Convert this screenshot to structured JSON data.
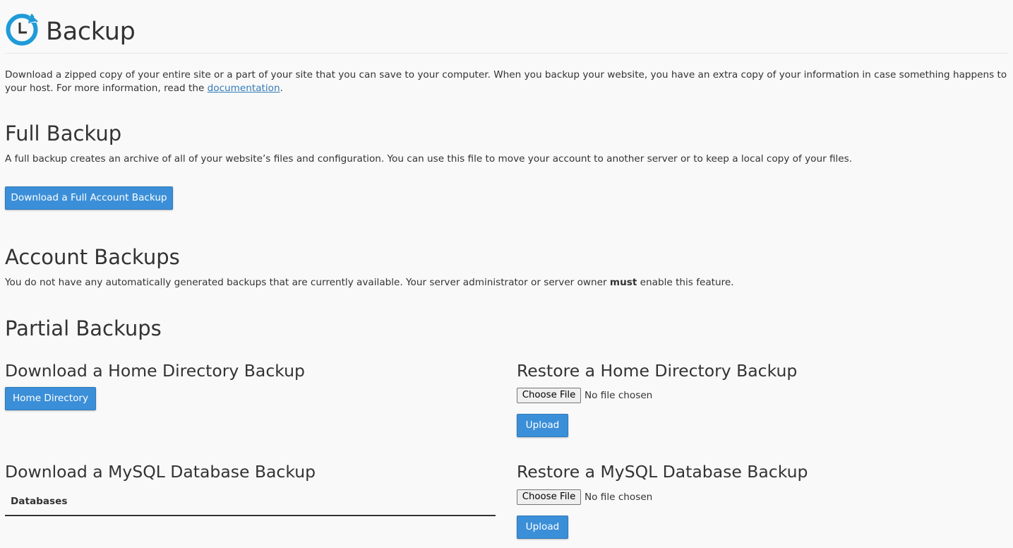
{
  "header": {
    "title": "Backup",
    "icon": "backup-clock-icon",
    "accent_color": "#1f9bd8"
  },
  "intro": {
    "text_before": "Download a zipped copy of your entire site or a part of your site that you can save to your computer. When you backup your website, you have an extra copy of your information in case something happens to your host. For more information, read the ",
    "link_text": "documentation",
    "text_after": "."
  },
  "full_backup": {
    "title": "Full Backup",
    "description": "A full backup creates an archive of all of your website’s files and configuration. You can use this file to move your account to another server or to keep a local copy of your files.",
    "button_label": "Download a Full Account Backup"
  },
  "account_backups": {
    "title": "Account Backups",
    "text_before": "You do not have any automatically generated backups that are currently available. Your server administrator or server owner ",
    "text_bold": "must",
    "text_after": " enable this feature."
  },
  "partial_backups": {
    "title": "Partial Backups",
    "home_download": {
      "title": "Download a Home Directory Backup",
      "button_label": "Home Directory"
    },
    "home_restore": {
      "title": "Restore a Home Directory Backup",
      "choose_label": "Choose File",
      "file_status": "No file chosen",
      "upload_label": "Upload"
    },
    "mysql_download": {
      "title": "Download a MySQL Database Backup",
      "column_header": "Databases"
    },
    "mysql_restore": {
      "title": "Restore a MySQL Database Backup",
      "choose_label": "Choose File",
      "file_status": "No file chosen",
      "upload_label": "Upload"
    }
  },
  "colors": {
    "primary_button": "#3b8fd8",
    "link": "#337ab7",
    "background": "#f9f9f9",
    "text": "#333333"
  }
}
